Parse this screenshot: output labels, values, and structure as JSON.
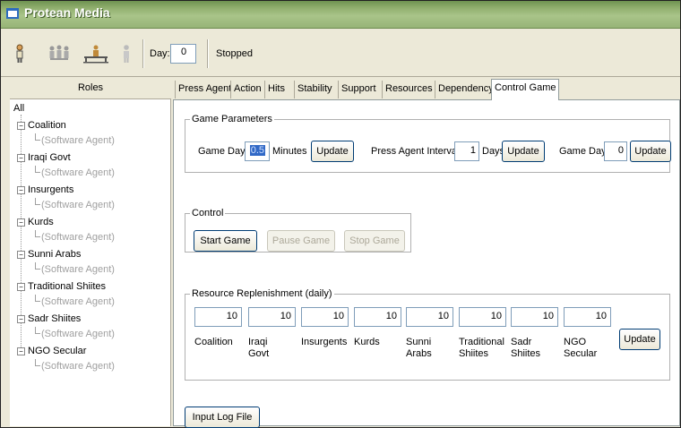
{
  "window": {
    "title": "Protean Media"
  },
  "toolbar": {
    "icons": [
      "person-icon",
      "group-icon",
      "building-icon",
      "person-gray-icon"
    ],
    "day_label": "Day:",
    "day_value": "0",
    "status": "Stopped"
  },
  "roles": {
    "header": "Roles",
    "root": "All",
    "items": [
      {
        "label": "Coalition",
        "child": "(Software Agent)"
      },
      {
        "label": "Iraqi Govt",
        "child": "(Software Agent)"
      },
      {
        "label": "Insurgents",
        "child": "(Software Agent)"
      },
      {
        "label": "Kurds",
        "child": "(Software Agent)"
      },
      {
        "label": "Sunni Arabs",
        "child": "(Software Agent)"
      },
      {
        "label": "Traditional Shiites",
        "child": "(Software Agent)"
      },
      {
        "label": "Sadr Shiites",
        "child": "(Software Agent)"
      },
      {
        "label": "NGO Secular",
        "child": "(Software Agent)"
      }
    ]
  },
  "tabs": [
    "Press Agent",
    "Action",
    "Hits",
    "Stability",
    "Support",
    "Resources",
    "Dependency",
    "Control Game"
  ],
  "active_tab": "Control Game",
  "game_parameters": {
    "legend": "Game Parameters",
    "game_day_label": "Game Day:",
    "game_day_minutes_value": "0.5",
    "minutes_label": "Minutes",
    "update_label": "Update",
    "press_interval_label": "Press Agent Interval:",
    "press_interval_value": "1",
    "days_label": "Days",
    "game_day2_label": "Game Day:",
    "game_day2_value": "0"
  },
  "control": {
    "legend": "Control",
    "start": "Start Game",
    "pause": "Pause Game",
    "stop": "Stop Game"
  },
  "replenishment": {
    "legend": "Resource Replenishment (daily)",
    "update_label": "Update",
    "items": [
      {
        "value": "10",
        "label": "Coalition"
      },
      {
        "value": "10",
        "label": "Iraqi Govt"
      },
      {
        "value": "10",
        "label": "Insurgents"
      },
      {
        "value": "10",
        "label": "Kurds"
      },
      {
        "value": "10",
        "label": "Sunni Arabs"
      },
      {
        "value": "10",
        "label": "Traditional Shiites"
      },
      {
        "value": "10",
        "label": "Sadr Shiites"
      },
      {
        "value": "10",
        "label": "NGO Secular"
      }
    ]
  },
  "log": {
    "input_label": "Input Log File"
  },
  "colors": {
    "titlebar": "#8fae6d",
    "window": "#ece9d8",
    "tree_child": "#a0a0a0"
  }
}
